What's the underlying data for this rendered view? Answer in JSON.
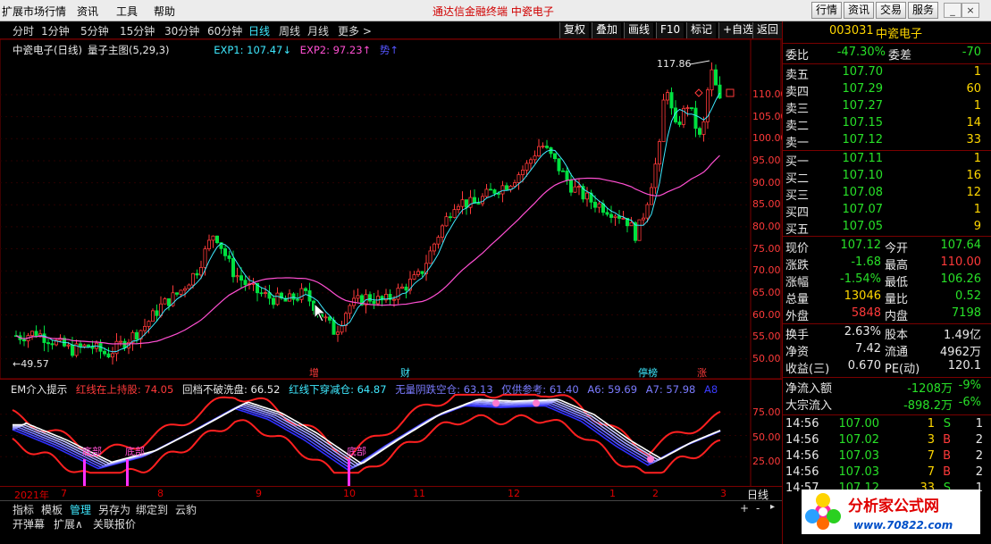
{
  "menu": {
    "items": [
      "扩展市场行情",
      "资讯",
      "工具",
      "帮助"
    ],
    "center_title": "通达信金融终端    中瓷电子",
    "right_buttons": [
      "行情",
      "资讯",
      "交易",
      "服务"
    ]
  },
  "periods": {
    "items": [
      "分时",
      "1分钟",
      "5分钟",
      "15分钟",
      "30分钟",
      "60分钟",
      "日线",
      "周线",
      "月线",
      "更多 >"
    ],
    "active": "日线",
    "tools": [
      "复权",
      "叠加",
      "画线",
      "F10",
      "标记",
      "+自选",
      "返回"
    ]
  },
  "main_chart": {
    "title": "中瓷电子(日线)",
    "indicator": "量子主图(5,29,3)",
    "exp1": "EXP1: 107.47↓",
    "exp2": "EXP2: 97.23↑",
    "exp3": "势↑",
    "high_label": "117.86",
    "low_label": "←49.57",
    "price_ticks": [
      "110.00",
      "105.00",
      "100.00",
      "95.00",
      "90.00",
      "85.00",
      "80.00",
      "75.00",
      "70.00",
      "65.00",
      "60.00",
      "55.00",
      "50.00"
    ],
    "signals": [
      {
        "text": "增",
        "color": "#ff3a3a"
      },
      {
        "text": "财",
        "color": "#3ee9ff"
      },
      {
        "text": "停榜",
        "color": "#3ee9ff"
      },
      {
        "text": "涨",
        "color": "#ff3a3a"
      }
    ],
    "colors": {
      "up": "#ff3a3a",
      "down": "#00e040",
      "ma_fast": "#3ee9ff",
      "ma_slow": "#ff4fd2"
    }
  },
  "indicator_panel": {
    "title": "EM介入提示",
    "legend": [
      {
        "text": "红线在上持股: 74.05",
        "color": "#ff3a3a"
      },
      {
        "text": "回档不破洗盘: 66.52",
        "color": "#e8e8e8"
      },
      {
        "text": "红线下穿减仓: 64.87",
        "color": "#3ee9ff"
      },
      {
        "text": "无量阴跌空仓: 63.13",
        "color": "#7b7bff"
      },
      {
        "text": "仅供参考: 61.40",
        "color": "#7b7bff"
      },
      {
        "text": "A6: 59.69",
        "color": "#7b7bff"
      },
      {
        "text": "A7: 57.98",
        "color": "#7b7bff"
      },
      {
        "text": "A8",
        "color": "#3b3bff"
      }
    ],
    "ticks": [
      "75.00",
      "50.00",
      "25.00"
    ],
    "marks": [
      "底部",
      "底部",
      "底部"
    ]
  },
  "date_axis": {
    "labels": [
      "2021年",
      "7",
      "8",
      "9",
      "10",
      "11",
      "12",
      "1",
      "2",
      "3"
    ],
    "period": "日线"
  },
  "bottom_tabs": {
    "row1": [
      "指标",
      "模板",
      "管理",
      "另存为",
      "绑定到",
      "云豹"
    ],
    "row1_active": "管理",
    "row2": [
      "开弹幕",
      "扩展∧",
      "关联报价"
    ]
  },
  "quote": {
    "code": "003031",
    "name": "中瓷电子",
    "weibi_label": "委比",
    "weibi": "-47.30%",
    "weicha_label": "委差",
    "weicha": "-70",
    "sells": [
      {
        "label": "卖五",
        "price": "107.70",
        "vol": "1"
      },
      {
        "label": "卖四",
        "price": "107.29",
        "vol": "60"
      },
      {
        "label": "卖三",
        "price": "107.27",
        "vol": "1"
      },
      {
        "label": "卖二",
        "price": "107.15",
        "vol": "14"
      },
      {
        "label": "卖一",
        "price": "107.12",
        "vol": "33"
      }
    ],
    "buys": [
      {
        "label": "买一",
        "price": "107.11",
        "vol": "1"
      },
      {
        "label": "买二",
        "price": "107.10",
        "vol": "16"
      },
      {
        "label": "买三",
        "price": "107.08",
        "vol": "12"
      },
      {
        "label": "买四",
        "price": "107.07",
        "vol": "1"
      },
      {
        "label": "买五",
        "price": "107.05",
        "vol": "9"
      }
    ],
    "stats": [
      {
        "l1": "现价",
        "v1": "107.12",
        "c1": "g",
        "l2": "今开",
        "v2": "107.64",
        "c2": "g"
      },
      {
        "l1": "涨跌",
        "v1": "-1.68",
        "c1": "g",
        "l2": "最高",
        "v2": "110.00",
        "c2": "r"
      },
      {
        "l1": "涨幅",
        "v1": "-1.54%",
        "c1": "g",
        "l2": "最低",
        "v2": "106.26",
        "c2": "g"
      },
      {
        "l1": "总量",
        "v1": "13046",
        "c1": "y",
        "l2": "量比",
        "v2": "0.52",
        "c2": "g"
      },
      {
        "l1": "外盘",
        "v1": "5848",
        "c1": "r",
        "l2": "内盘",
        "v2": "7198",
        "c2": "g"
      }
    ],
    "stats2": [
      {
        "l1": "换手",
        "v1": "2.63%",
        "l2": "股本",
        "v2": "1.49亿"
      },
      {
        "l1": "净资",
        "v1": "7.42",
        "l2": "流通",
        "v2": "4962万"
      },
      {
        "l1": "收益(三)",
        "v1": "0.670",
        "l2": "PE(动)",
        "v2": "120.1"
      }
    ],
    "flow": [
      {
        "label": "净流入额",
        "value": "-1208万",
        "pct": "-9%"
      },
      {
        "label": "大宗流入",
        "value": "-898.2万",
        "pct": "-6%"
      }
    ],
    "ticks": [
      {
        "time": "14:56",
        "price": "107.00",
        "vol": "1",
        "side": "S"
      },
      {
        "time": "14:56",
        "price": "107.02",
        "vol": "3",
        "side": "B"
      },
      {
        "time": "14:56",
        "price": "107.03",
        "vol": "7",
        "side": "B"
      },
      {
        "time": "14:56",
        "price": "107.03",
        "vol": "7",
        "side": "B"
      },
      {
        "time": "14:57",
        "price": "107.12",
        "vol": "33",
        "side": "S"
      }
    ],
    "tick_counts": [
      "1",
      "2",
      "2",
      "2",
      "1"
    ]
  },
  "logo": {
    "cn": "分析家公式网",
    "url": "www.70822.com"
  }
}
